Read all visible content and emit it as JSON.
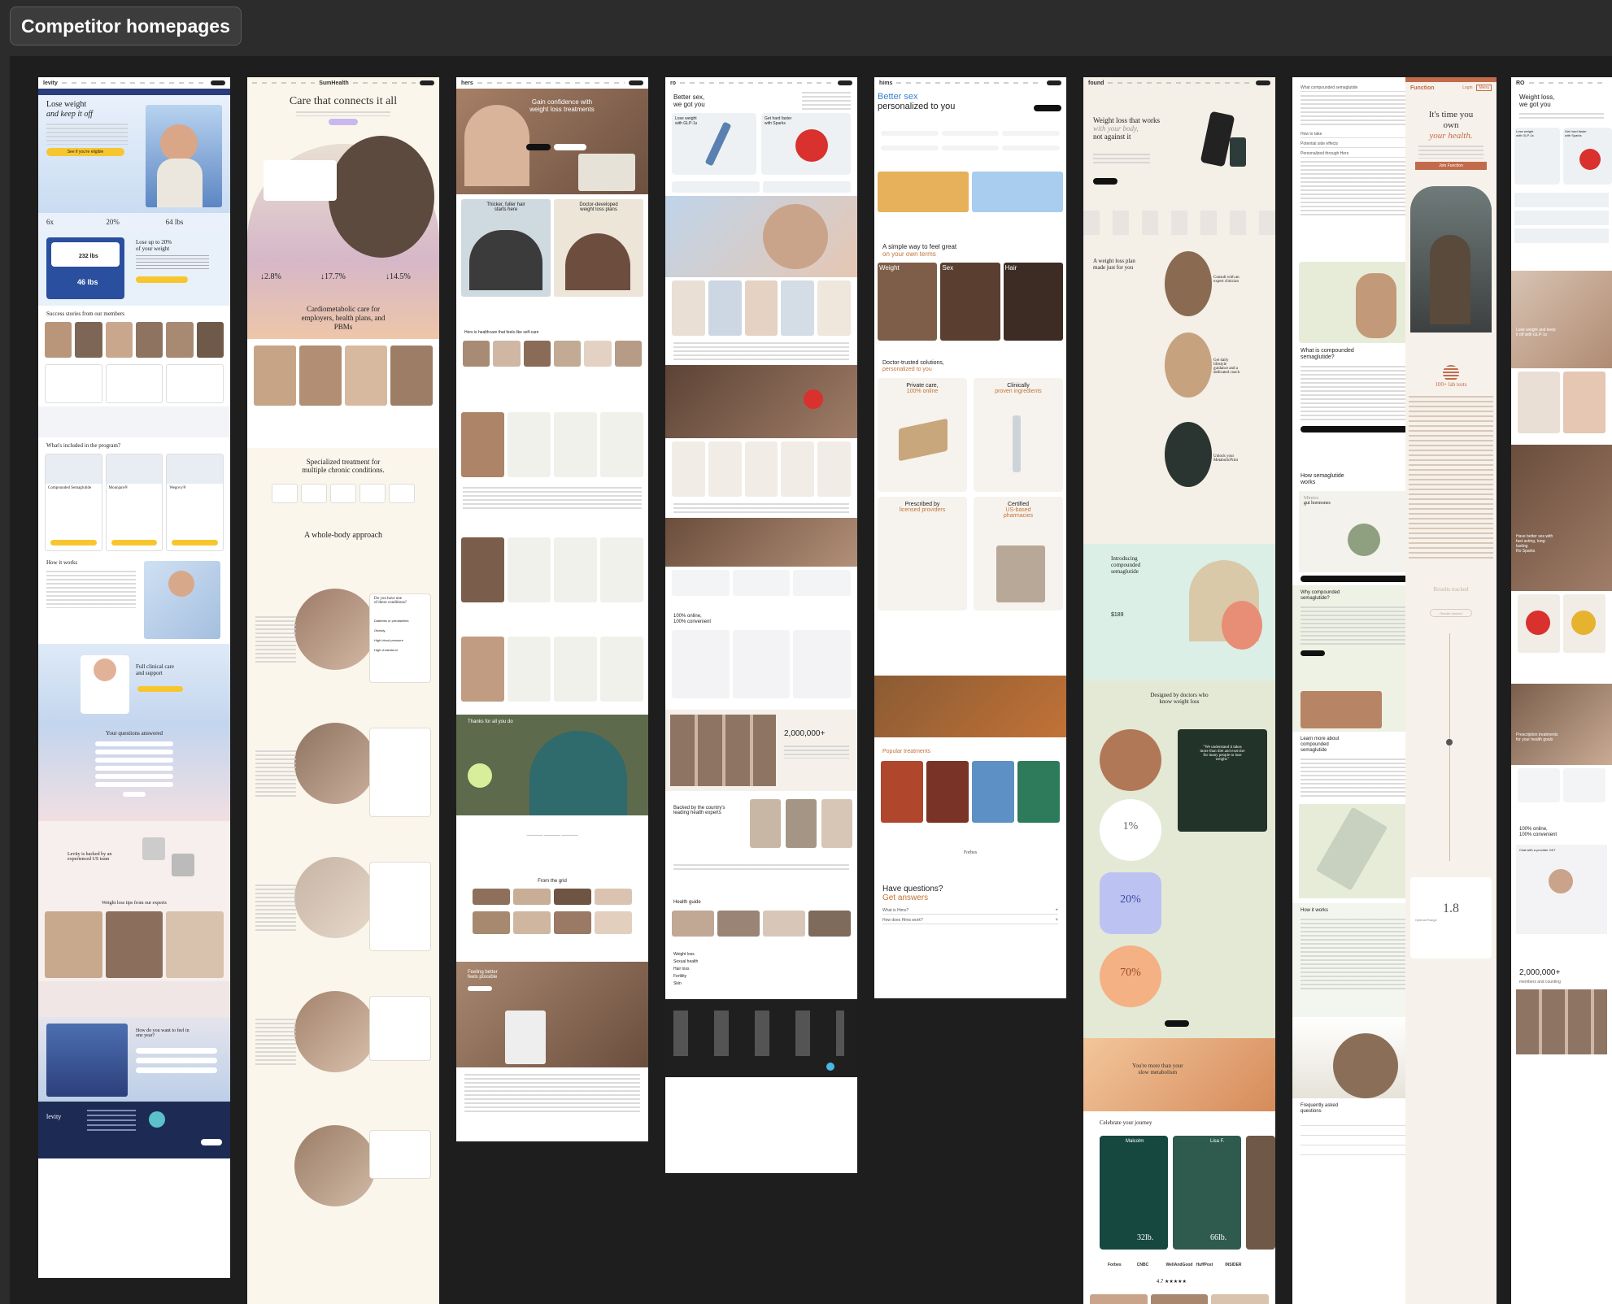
{
  "frame": {
    "title": "Competitor homepages"
  },
  "levity": {
    "logo": "levity",
    "hero_title_line1": "Lose weight",
    "hero_title_line2": "and keep it off",
    "cta": "See if you're eligible",
    "stat1": "6x",
    "stat2": "20%",
    "stat3": "64 lbs",
    "calc_title_line1": "Lose up to 20%",
    "calc_title_line2": "of your weight",
    "calc_current": "232 lbs",
    "calc_loss": "46 lbs",
    "stories": "Success stories from our members",
    "included": "What's included in the program?",
    "drug1": "Compounded Semaglutide",
    "drug2": "Mounjaro®",
    "drug3": "Wegovy®",
    "how": "How it works",
    "clinical_line1": "Full clinical care",
    "clinical_line2": "and support",
    "questions": "Your questions answered",
    "backed_line1": "Levity is backed by an",
    "backed_line2": "experienced US team",
    "tips": "Weight loss tips from our experts",
    "feel_line1": "How do you want to feel in",
    "feel_line2": "one year?",
    "footer_logo": "levity"
  },
  "sum": {
    "logo": "SumHealth",
    "hero": "Care that connects it all",
    "stat1": "↓2.8%",
    "stat2": "↓17.7%",
    "stat3": "↓14.5%",
    "cardio_line1": "Cardiometabolic care for",
    "cardio_line2": "employers, health plans, and",
    "cardio_line3": "PBMs",
    "special_line1": "Specialized treatment for",
    "special_line2": "multiple chronic conditions.",
    "whole": "A whole-body approach",
    "q1_line1": "Do you have one",
    "q1_line2": "of these conditions?",
    "opt1": "Diabetes or prediabetes",
    "opt2": "Obesity",
    "opt3": "High blood pressure",
    "opt4": "High cholesterol"
  },
  "hers": {
    "hero_line1": "Gain confidence with",
    "hero_line2": "weight loss treatments",
    "card1_line1": "Thicker, fuller hair",
    "card1_line2": "starts here",
    "card2_line1": "Doctor-developed",
    "card2_line2": "weight loss plans",
    "selfcare": "Hers is healthcare that feels like self-care",
    "thanks": "Thanks for all you do",
    "grid": "From the grid",
    "feeling_line1": "Feeling better",
    "feeling_line2": "feels possible"
  },
  "ro": {
    "logo": "ro",
    "hero_line1": "Better sex,",
    "hero_line2": "we got you",
    "card1_line1": "Lose weight",
    "card1_line2": "with GLP-1s",
    "card2_line1": "Get hard faster",
    "card2_line2": "with Sparks",
    "online_line1": "100% online,",
    "online_line2": "100% convenient",
    "members": "2,000,000+",
    "backed_line1": "Backed by the country's",
    "backed_line2": "leading health experts",
    "guide": "Health guide",
    "links": [
      "Weight loss",
      "Sexual health",
      "Hair loss",
      "Fertility",
      "Skin"
    ]
  },
  "hims": {
    "logo": "hims",
    "hero_line1": "Better sex",
    "hero_line2": "personalized to you",
    "simple_line1": "A simple way to feel great",
    "simple_line2": "on your own terms",
    "cat1": "Weight",
    "cat2": "Sex",
    "cat3": "Hair",
    "trusted_line1": "Doctor-trusted solutions,",
    "trusted_line2": "personalized to you",
    "f1_line1": "Private care,",
    "f1_line2": "100% online",
    "f2_line1": "Clinically",
    "f2_line2": "proven ingredients",
    "f3_line1": "Prescribed by",
    "f3_line2": "licensed providers",
    "f4_line1": "Certified",
    "f4_line2": "US-based",
    "f4_line3": "pharmacies",
    "popular": "Popular treatments",
    "press": "Forbes",
    "haveq": "Have questions?",
    "get": "Get answers",
    "faq1": "What is Hims?",
    "faq2": "How does Hims work?"
  },
  "found": {
    "logo": "found",
    "hero_line1": "Weight loss that works",
    "hero_line2": "with your body,",
    "hero_line3": "not against it",
    "plan_line1": "A weight loss plan",
    "plan_line2": "made just for you",
    "consult_line1": "Consult with an",
    "consult_line2": "expert clinician",
    "daily_line1": "Get daily",
    "daily_line2": "lifestyle",
    "daily_line3": "guidance and a",
    "daily_line4": "dedicated coach",
    "unlock_line1": "Unlock your",
    "unlock_line2": "MetabolicPrint",
    "intro_line1": "Introducing",
    "intro_line2": "compounded",
    "intro_line3": "semaglutide",
    "price": "$189",
    "designed_line1": "Designed by doctors who",
    "designed_line2": "know weight loss",
    "quote_line1": "\"We understand it takes",
    "quote_line2": "more than diet and exercise",
    "quote_line3": "for many people to lose",
    "quote_line4": "weight.\"",
    "p1": "1%",
    "p2": "20%",
    "p3": "70%",
    "more_line1": "You're more than your",
    "more_line2": "slow metabolism",
    "journey": "Celebrate your journey",
    "n1": "Malcolm",
    "n2": "Lisa F.",
    "w1": "32lb.",
    "w2": "66lb.",
    "press": [
      "Forbes",
      "CNBC",
      "WellAndGood",
      "HuffPost",
      "INSIDER"
    ],
    "rating": "4.7 ★★★★★"
  },
  "col7": {
    "faq_top": [
      "What compounded semaglutide",
      "How to take",
      "Potential side effects",
      "Personalized through Hers"
    ],
    "what_line1": "What is compounded",
    "what_line2": "semaglutide?",
    "how_line1": "How semaglutide",
    "how_line2": "works",
    "mimics_line1": "Mimics",
    "mimics_line2": "gut hormones",
    "why_line1": "Why compounded",
    "why_line2": "semaglutide?",
    "learn_line1": "Learn more about",
    "learn_line2": "compounded",
    "learn_line3": "semaglutide",
    "how_works": "How it works",
    "freq_line1": "Frequently asked",
    "freq_line2": "questions"
  },
  "function": {
    "logo": "Function",
    "login": "Login",
    "menu": "Menu",
    "hero_line1": "It's time you",
    "hero_line2": "own",
    "hero_line3": "your health.",
    "cta": "Join Function",
    "tests": "100+ lab tests",
    "results": "Results tracked",
    "results2": "Results tracked",
    "big": "1.8",
    "range": "Optimal Range"
  },
  "ro2": {
    "logo": "RO",
    "hero_line1": "Weight loss,",
    "hero_line2": "we got you",
    "c1_line1": "Lose weight",
    "c1_line2": "with GLP-1s",
    "c2_line1": "Get hard faster",
    "c2_line2": "with Sparks",
    "keep_line1": "Lose weight and keep",
    "keep_line2": "it off with GLP-1s",
    "better_line1": "Have better sex with",
    "better_line2": "fast-acting, long-",
    "better_line3": "lasting",
    "better_line4": "Ro Sparks",
    "rx_line1": "Prescription treatments",
    "rx_line2": "for your health goals",
    "online_line1": "100% online,",
    "online_line2": "100% convenient",
    "chat": "Chat with a provider 24/7",
    "members": "2,000,000+",
    "members_sub": "members and counting"
  }
}
